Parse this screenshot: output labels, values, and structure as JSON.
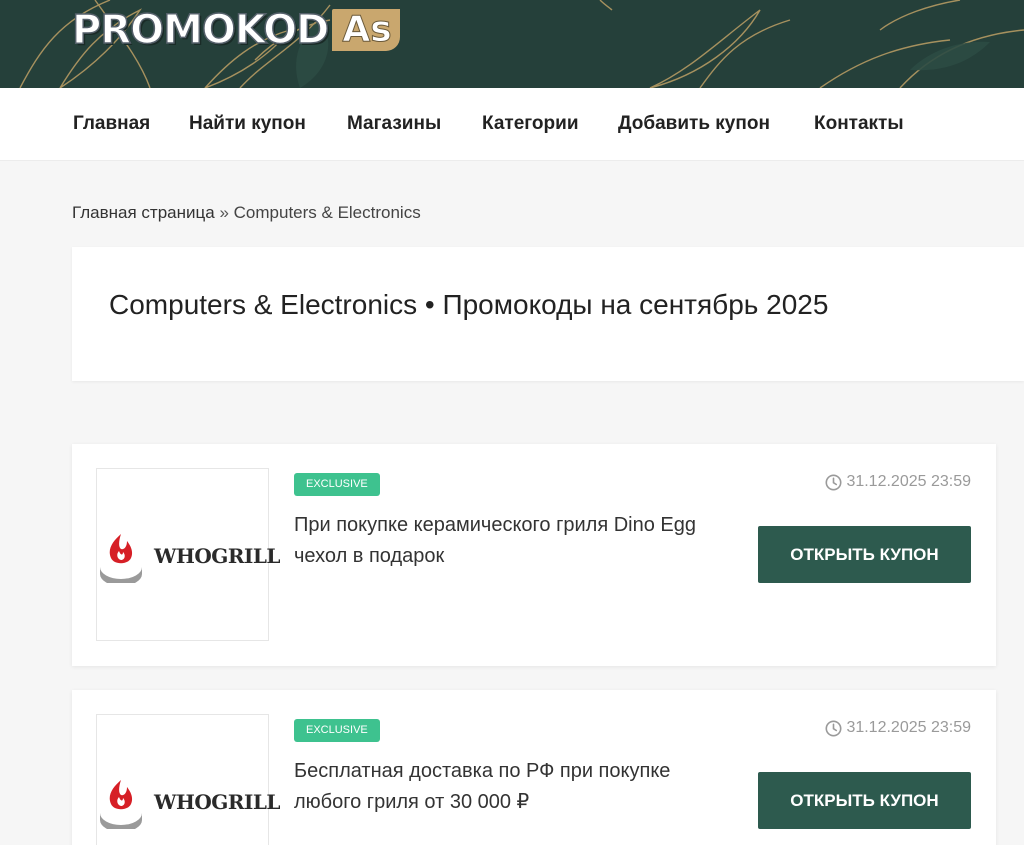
{
  "header": {
    "logo_main": "PROMOKOD",
    "logo_badge": "As",
    "colors": {
      "header_bg": "#25403a",
      "leaf_gold": "#b59a63",
      "logo_badge_bg": "#c9a76e"
    }
  },
  "nav": {
    "items": [
      {
        "label": "Главная"
      },
      {
        "label": "Найти купон"
      },
      {
        "label": "Магазины"
      },
      {
        "label": "Категории"
      },
      {
        "label": "Добавить купон"
      },
      {
        "label": "Контакты"
      }
    ]
  },
  "breadcrumb": {
    "home": "Главная страница",
    "separator": "»",
    "current": "Computers & Electronics"
  },
  "page": {
    "title": "Computers & Electronics • Промокоды на сентябрь 2025"
  },
  "coupons": [
    {
      "store_logo_text": "WHOGRILL",
      "store_logo_icon": "flame-icon",
      "badge": "EXCLUSIVE",
      "description": "При покупке керамического гриля Dino Egg чехол в подарок",
      "expiry": "31.12.2025 23:59",
      "button": "ОТКРЫТЬ КУПОН"
    },
    {
      "store_logo_text": "WHOGRILL",
      "store_logo_icon": "flame-icon",
      "badge": "EXCLUSIVE",
      "description": "Бесплатная доставка по РФ при покупке любого гриля от 30 000 ₽",
      "expiry": "31.12.2025 23:59",
      "button": "ОТКРЫТЬ КУПОН"
    }
  ],
  "colors": {
    "accent_button": "#2d5a4e",
    "badge_green": "#3ec28f",
    "page_bg": "#f6f6f6"
  }
}
